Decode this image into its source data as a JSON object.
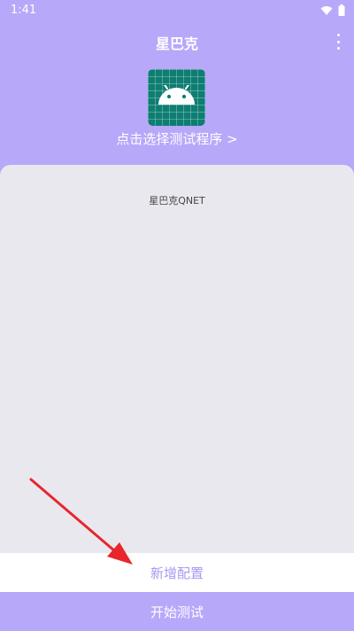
{
  "status_bar": {
    "time": "1:41"
  },
  "header": {
    "title": "星巴克"
  },
  "app_selector": {
    "link_text": "点击选择测试程序 >"
  },
  "content": {
    "title": "星巴克QNET"
  },
  "actions": {
    "add_config": "新增配置",
    "start_test": "开始测试"
  },
  "colors": {
    "primary": "#b7a8fa",
    "card": "#e9e8ef",
    "app_icon": "#0e7d72",
    "annotation_arrow": "#e8262c"
  },
  "icons": [
    "wifi-icon",
    "battery-icon",
    "more-vert-icon",
    "android-icon"
  ]
}
